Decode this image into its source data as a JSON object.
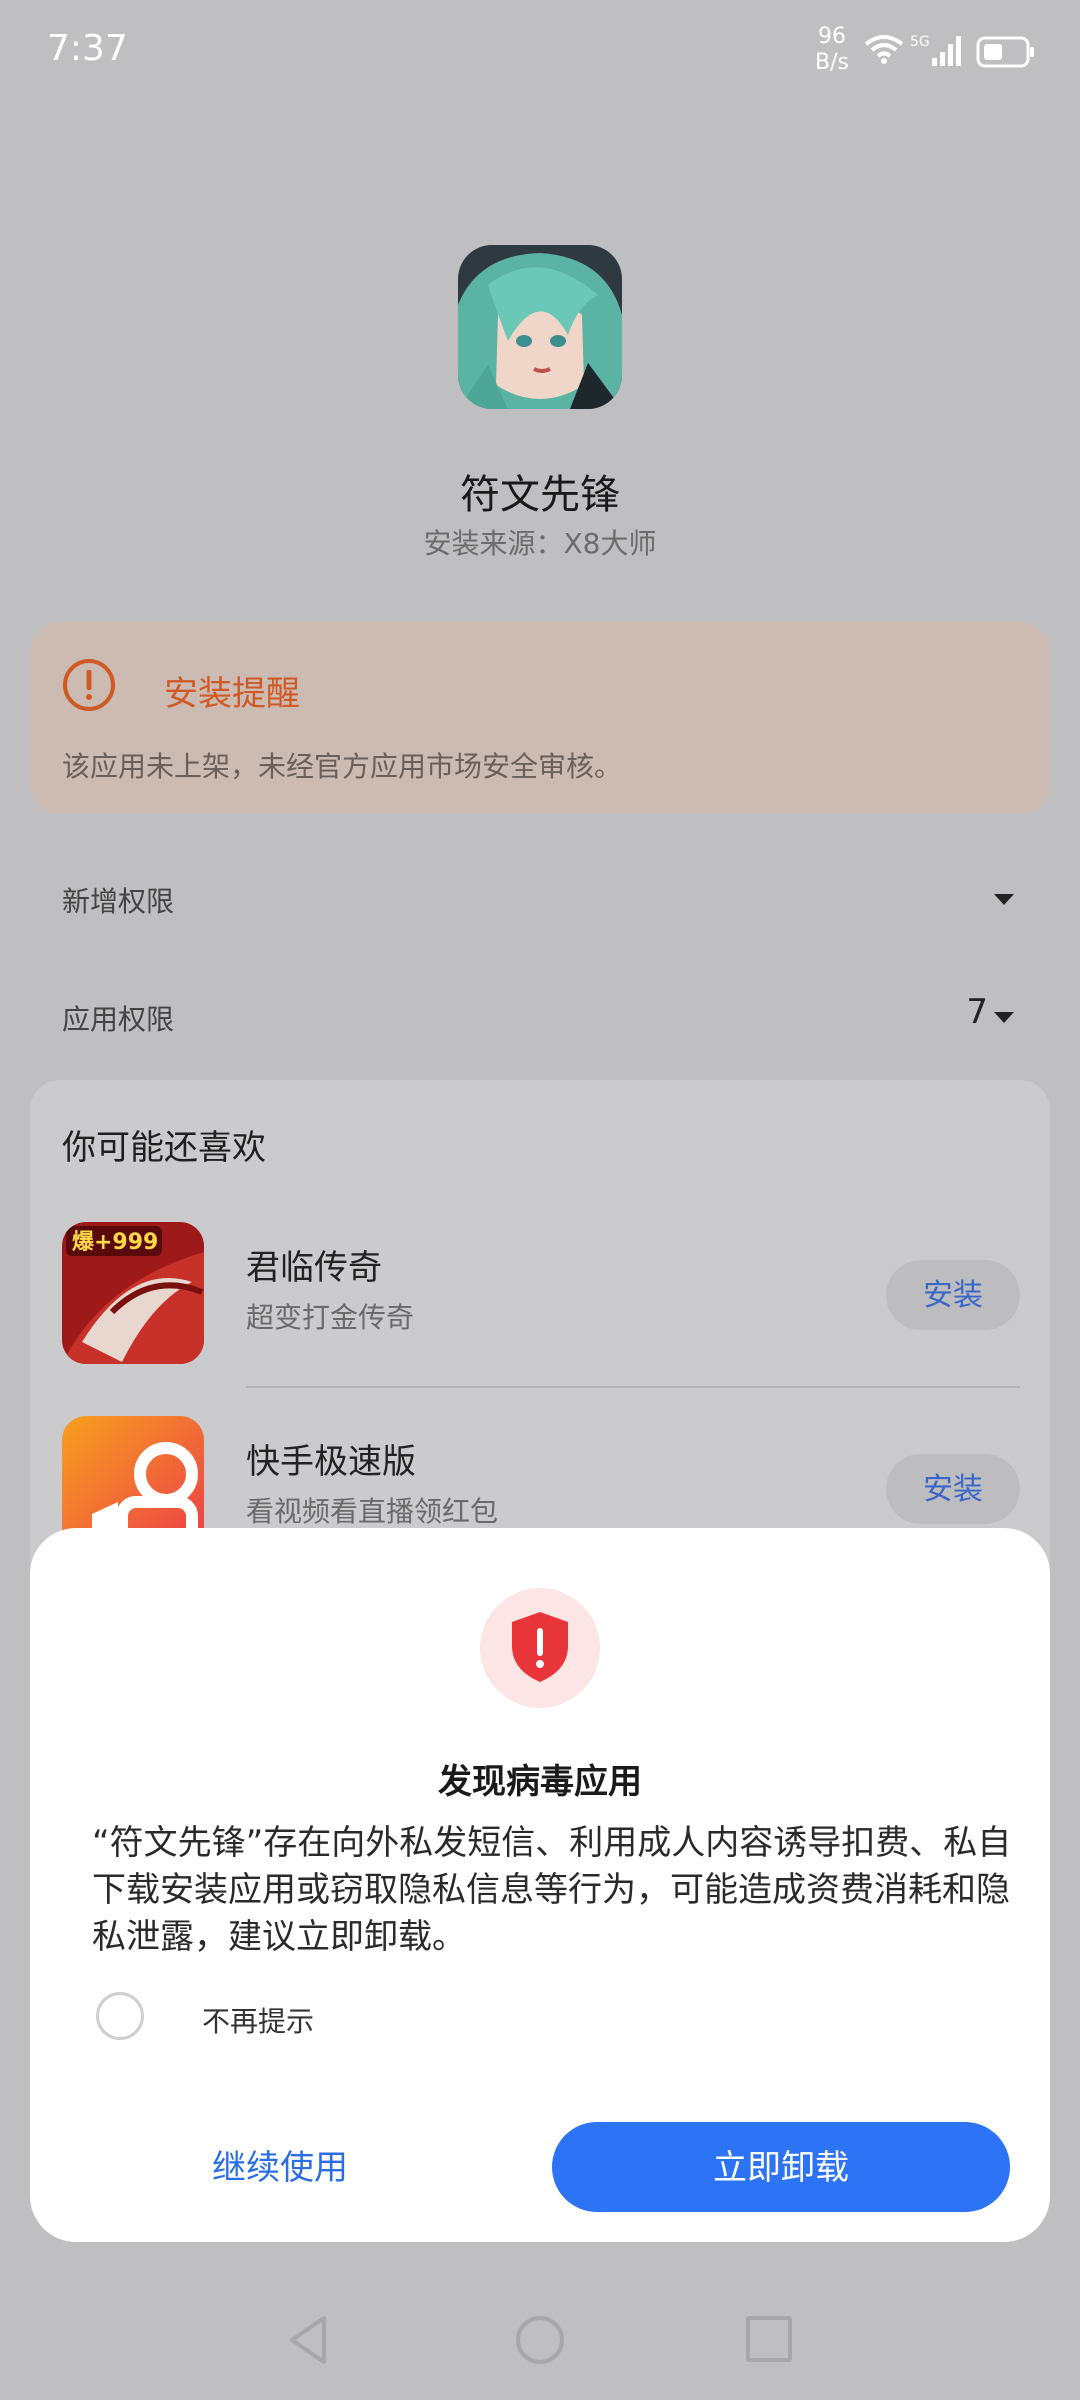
{
  "status_bar": {
    "time": "7:37",
    "net_speed_value": "96",
    "net_speed_unit": "B/s",
    "network_type": "5G",
    "icons": [
      "wifi-icon",
      "signal-icon",
      "battery-icon"
    ]
  },
  "app": {
    "name": "符文先锋",
    "install_source": "安装来源：X8大师",
    "icon": "app-icon-anime-girl"
  },
  "warning": {
    "title": "安装提醒",
    "text": "该应用未上架，未经官方应用市场安全审核。",
    "icon": "exclamation-circle-icon",
    "accent_color": "#d05a25"
  },
  "permissions": {
    "new": {
      "label": "新增权限"
    },
    "app": {
      "label": "应用权限",
      "count": "7"
    }
  },
  "recommend": {
    "title": "你可能还喜欢",
    "items": [
      {
        "name": "君临传奇",
        "desc": "超变打金传奇",
        "button": "安装",
        "icon_badge": "爆+999"
      },
      {
        "name": "快手极速版",
        "desc": "看视频看直播领红包",
        "button": "安装"
      }
    ]
  },
  "dialog": {
    "title": "发现病毒应用",
    "message": "“符文先锋”存在向外私发短信、利用成人内容诱导扣费、私自下载安装应用或窃取隐私信息等行为，可能造成资费消耗和隐私泄露，建议立即卸载。",
    "dont_remind": "不再提示",
    "continue_label": "继续使用",
    "uninstall_label": "立即卸载",
    "icon": "shield-alert-icon",
    "primary_color": "#2d73f5",
    "danger_color": "#e8353a"
  },
  "nav_bar": {
    "icons": [
      "back-icon",
      "home-icon",
      "recents-icon"
    ]
  }
}
